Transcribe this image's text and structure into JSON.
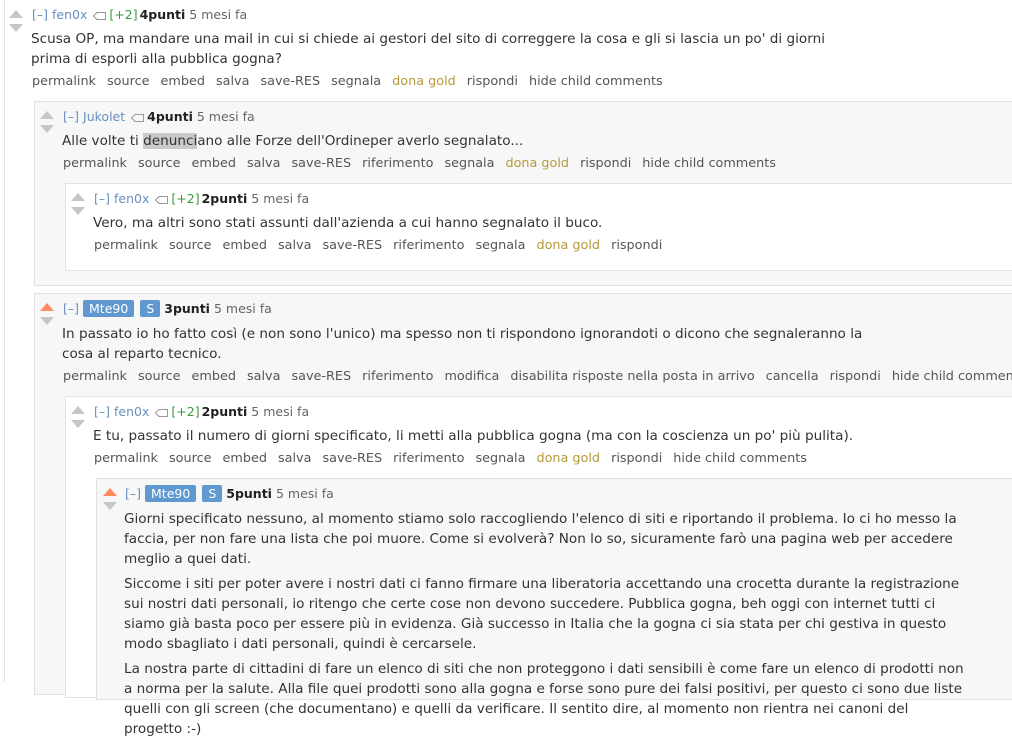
{
  "common": {
    "collapse": "[–]",
    "points_suffix": "punti",
    "time": "5 mesi fa",
    "flair": "[+2]",
    "s_badge": "S"
  },
  "c1": {
    "author": "fen0x",
    "score": "4",
    "body": "Scusa OP, ma mandare una mail in cui si chiede ai gestori del sito di correggere la cosa e gli si lascia un po' di giorni prima di esporli alla pubblica gogna?",
    "links": [
      "permalink",
      "source",
      "embed",
      "salva",
      "save-RES",
      "segnala",
      "dona gold",
      "rispondi",
      "hide child comments"
    ]
  },
  "c2": {
    "author": "Jukolet",
    "score": "4",
    "body_pre": "Alle volte ti ",
    "body_hl": "denunci",
    "body_post": "ano alle Forze dell'Ordineper averlo segnalato...",
    "links": [
      "permalink",
      "source",
      "embed",
      "salva",
      "save-RES",
      "riferimento",
      "segnala",
      "dona gold",
      "rispondi",
      "hide child comments"
    ]
  },
  "c3": {
    "author": "fen0x",
    "score": "2",
    "body": "Vero, ma altri sono stati assunti dall'azienda a cui hanno segnalato il buco.",
    "links": [
      "permalink",
      "source",
      "embed",
      "salva",
      "save-RES",
      "riferimento",
      "segnala",
      "dona gold",
      "rispondi"
    ]
  },
  "c4": {
    "author": "Mte90",
    "score": "3",
    "body": "In passato io ho fatto così (e non sono l'unico) ma spesso non ti rispondono ignorandoti o dicono che segnaleranno la cosa al reparto tecnico.",
    "links": [
      "permalink",
      "source",
      "embed",
      "salva",
      "save-RES",
      "riferimento",
      "modifica",
      "disabilita risposte nella posta in arrivo",
      "cancella",
      "rispondi",
      "hide child comments"
    ]
  },
  "c5": {
    "author": "fen0x",
    "score": "2",
    "body": "E tu, passato il numero di giorni specificato, li metti alla pubblica gogna (ma con la coscienza un po' più pulita).",
    "links": [
      "permalink",
      "source",
      "embed",
      "salva",
      "save-RES",
      "riferimento",
      "segnala",
      "dona gold",
      "rispondi",
      "hide child comments"
    ]
  },
  "c6": {
    "author": "Mte90",
    "score": "5",
    "p1": "Giorni specificato nessuno, al momento stiamo solo raccogliendo l'elenco di siti e riportando il problema. Io ci ho messo la faccia, per non fare una lista che poi muore. Come si evolverà? Non lo so, sicuramente farò una pagina web per accedere meglio a quei dati.",
    "p2": "Siccome i siti per poter avere i nostri dati ci fanno firmare una liberatoria accettando una crocetta durante la registrazione sui nostri dati personali, io ritengo che certe cose non devono succedere. Pubblica gogna, beh oggi con internet tutti ci siamo già basta poco per essere più in evidenza. Già successo in Italia che la gogna ci sia stata per chi gestiva in questo modo sbagliato i dati personali, quindi è cercarsele.",
    "p3": "La nostra parte di cittadini di fare un elenco di siti che non proteggono i dati sensibili è come fare un elenco di prodotti non a norma per la salute. Alla file quei prodotti sono alla gogna e forse sono pure dei falsi positivi, per questo ci sono due liste quelli con gli screen (che documentano) e quelli da verificare. Il sentito dire, al momento non rientra nei canoni del progetto :-)"
  }
}
